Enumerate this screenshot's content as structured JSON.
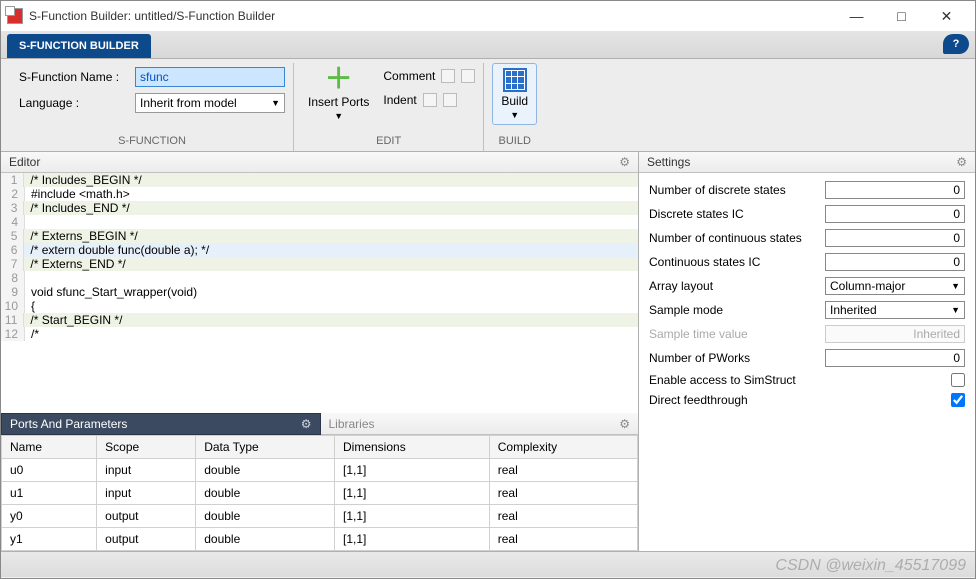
{
  "window": {
    "title": "S-Function Builder: untitled/S-Function Builder",
    "min": "—",
    "max": "□",
    "close": "✕"
  },
  "app_tab": "S-FUNCTION BUILDER",
  "help_icon": "?",
  "ribbon": {
    "sfunc": {
      "name_label": "S-Function Name :",
      "name_value": "sfunc",
      "lang_label": "Language :",
      "lang_value": "Inherit from model",
      "title": "S-FUNCTION"
    },
    "edit": {
      "insert_ports": "Insert Ports",
      "comment": "Comment",
      "indent": "Indent",
      "title": "EDIT"
    },
    "build": {
      "build": "Build",
      "title": "BUILD"
    }
  },
  "panels": {
    "editor": "Editor",
    "ports": "Ports And Parameters",
    "libraries": "Libraries",
    "settings": "Settings"
  },
  "code": [
    {
      "n": "1",
      "t": "/* Includes_BEGIN */",
      "hl": true
    },
    {
      "n": "2",
      "t": "#include <math.h>"
    },
    {
      "n": "3",
      "t": "/* Includes_END */",
      "hl": true
    },
    {
      "n": "4",
      "t": ""
    },
    {
      "n": "5",
      "t": "/* Externs_BEGIN */",
      "hl": true
    },
    {
      "n": "6",
      "t": "/* extern double func(double a); */",
      "cur": true
    },
    {
      "n": "7",
      "t": "/* Externs_END */",
      "hl": true
    },
    {
      "n": "8",
      "t": ""
    },
    {
      "n": "9",
      "t": "void sfunc_Start_wrapper(void)"
    },
    {
      "n": "10",
      "t": "{"
    },
    {
      "n": "11",
      "t": "/* Start_BEGIN */",
      "hl": true
    },
    {
      "n": "12",
      "t": "/*"
    }
  ],
  "ports_table": {
    "headers": [
      "Name",
      "Scope",
      "Data Type",
      "Dimensions",
      "Complexity"
    ],
    "rows": [
      [
        "u0",
        "input",
        "double",
        "[1,1]",
        "real"
      ],
      [
        "u1",
        "input",
        "double",
        "[1,1]",
        "real"
      ],
      [
        "y0",
        "output",
        "double",
        "[1,1]",
        "real"
      ],
      [
        "y1",
        "output",
        "double",
        "[1,1]",
        "real"
      ]
    ]
  },
  "settings": {
    "num_discrete_label": "Number of discrete states",
    "num_discrete": "0",
    "discrete_ic_label": "Discrete states IC",
    "discrete_ic": "0",
    "num_cont_label": "Number of continuous states",
    "num_cont": "0",
    "cont_ic_label": "Continuous states IC",
    "cont_ic": "0",
    "array_layout_label": "Array layout",
    "array_layout": "Column-major",
    "sample_mode_label": "Sample mode",
    "sample_mode": "Inherited",
    "sample_time_label": "Sample time value",
    "sample_time": "Inherited",
    "pworks_label": "Number of PWorks",
    "pworks": "0",
    "simstruct_label": "Enable access to SimStruct",
    "feedthrough_label": "Direct feedthrough"
  },
  "watermark": "CSDN @weixin_45517099"
}
